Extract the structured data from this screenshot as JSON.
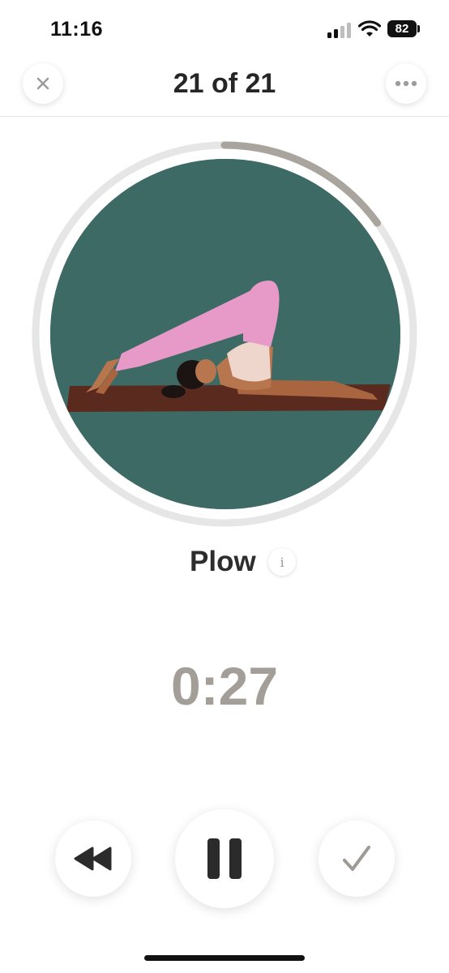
{
  "status_bar": {
    "time": "11:16",
    "battery_level": "82",
    "signal_icon": "cellular-signal-icon",
    "wifi_icon": "wifi-icon",
    "battery_icon": "battery-icon"
  },
  "header": {
    "title": "21 of 21",
    "close_icon": "close-icon",
    "more_icon": "more-options-icon"
  },
  "exercise": {
    "name": "Plow",
    "illustration": "plow-pose-illustration",
    "info_icon": "info-icon",
    "info_symbol": "i",
    "progress_ring_fraction": 0.15
  },
  "timer": {
    "remaining": "0:27"
  },
  "controls": {
    "rewind_icon": "rewind-icon",
    "pause_icon": "pause-icon",
    "complete_icon": "checkmark-icon"
  },
  "colors": {
    "illustration_background": "#3d6a64",
    "mat": "#5a2a1e",
    "leggings": "#e79ac7",
    "top": "#efd6cc",
    "skin": "#b8764e",
    "ring_track": "#e6e6e6",
    "ring_progress": "#a9a49e",
    "timer_text": "#a39e98"
  }
}
